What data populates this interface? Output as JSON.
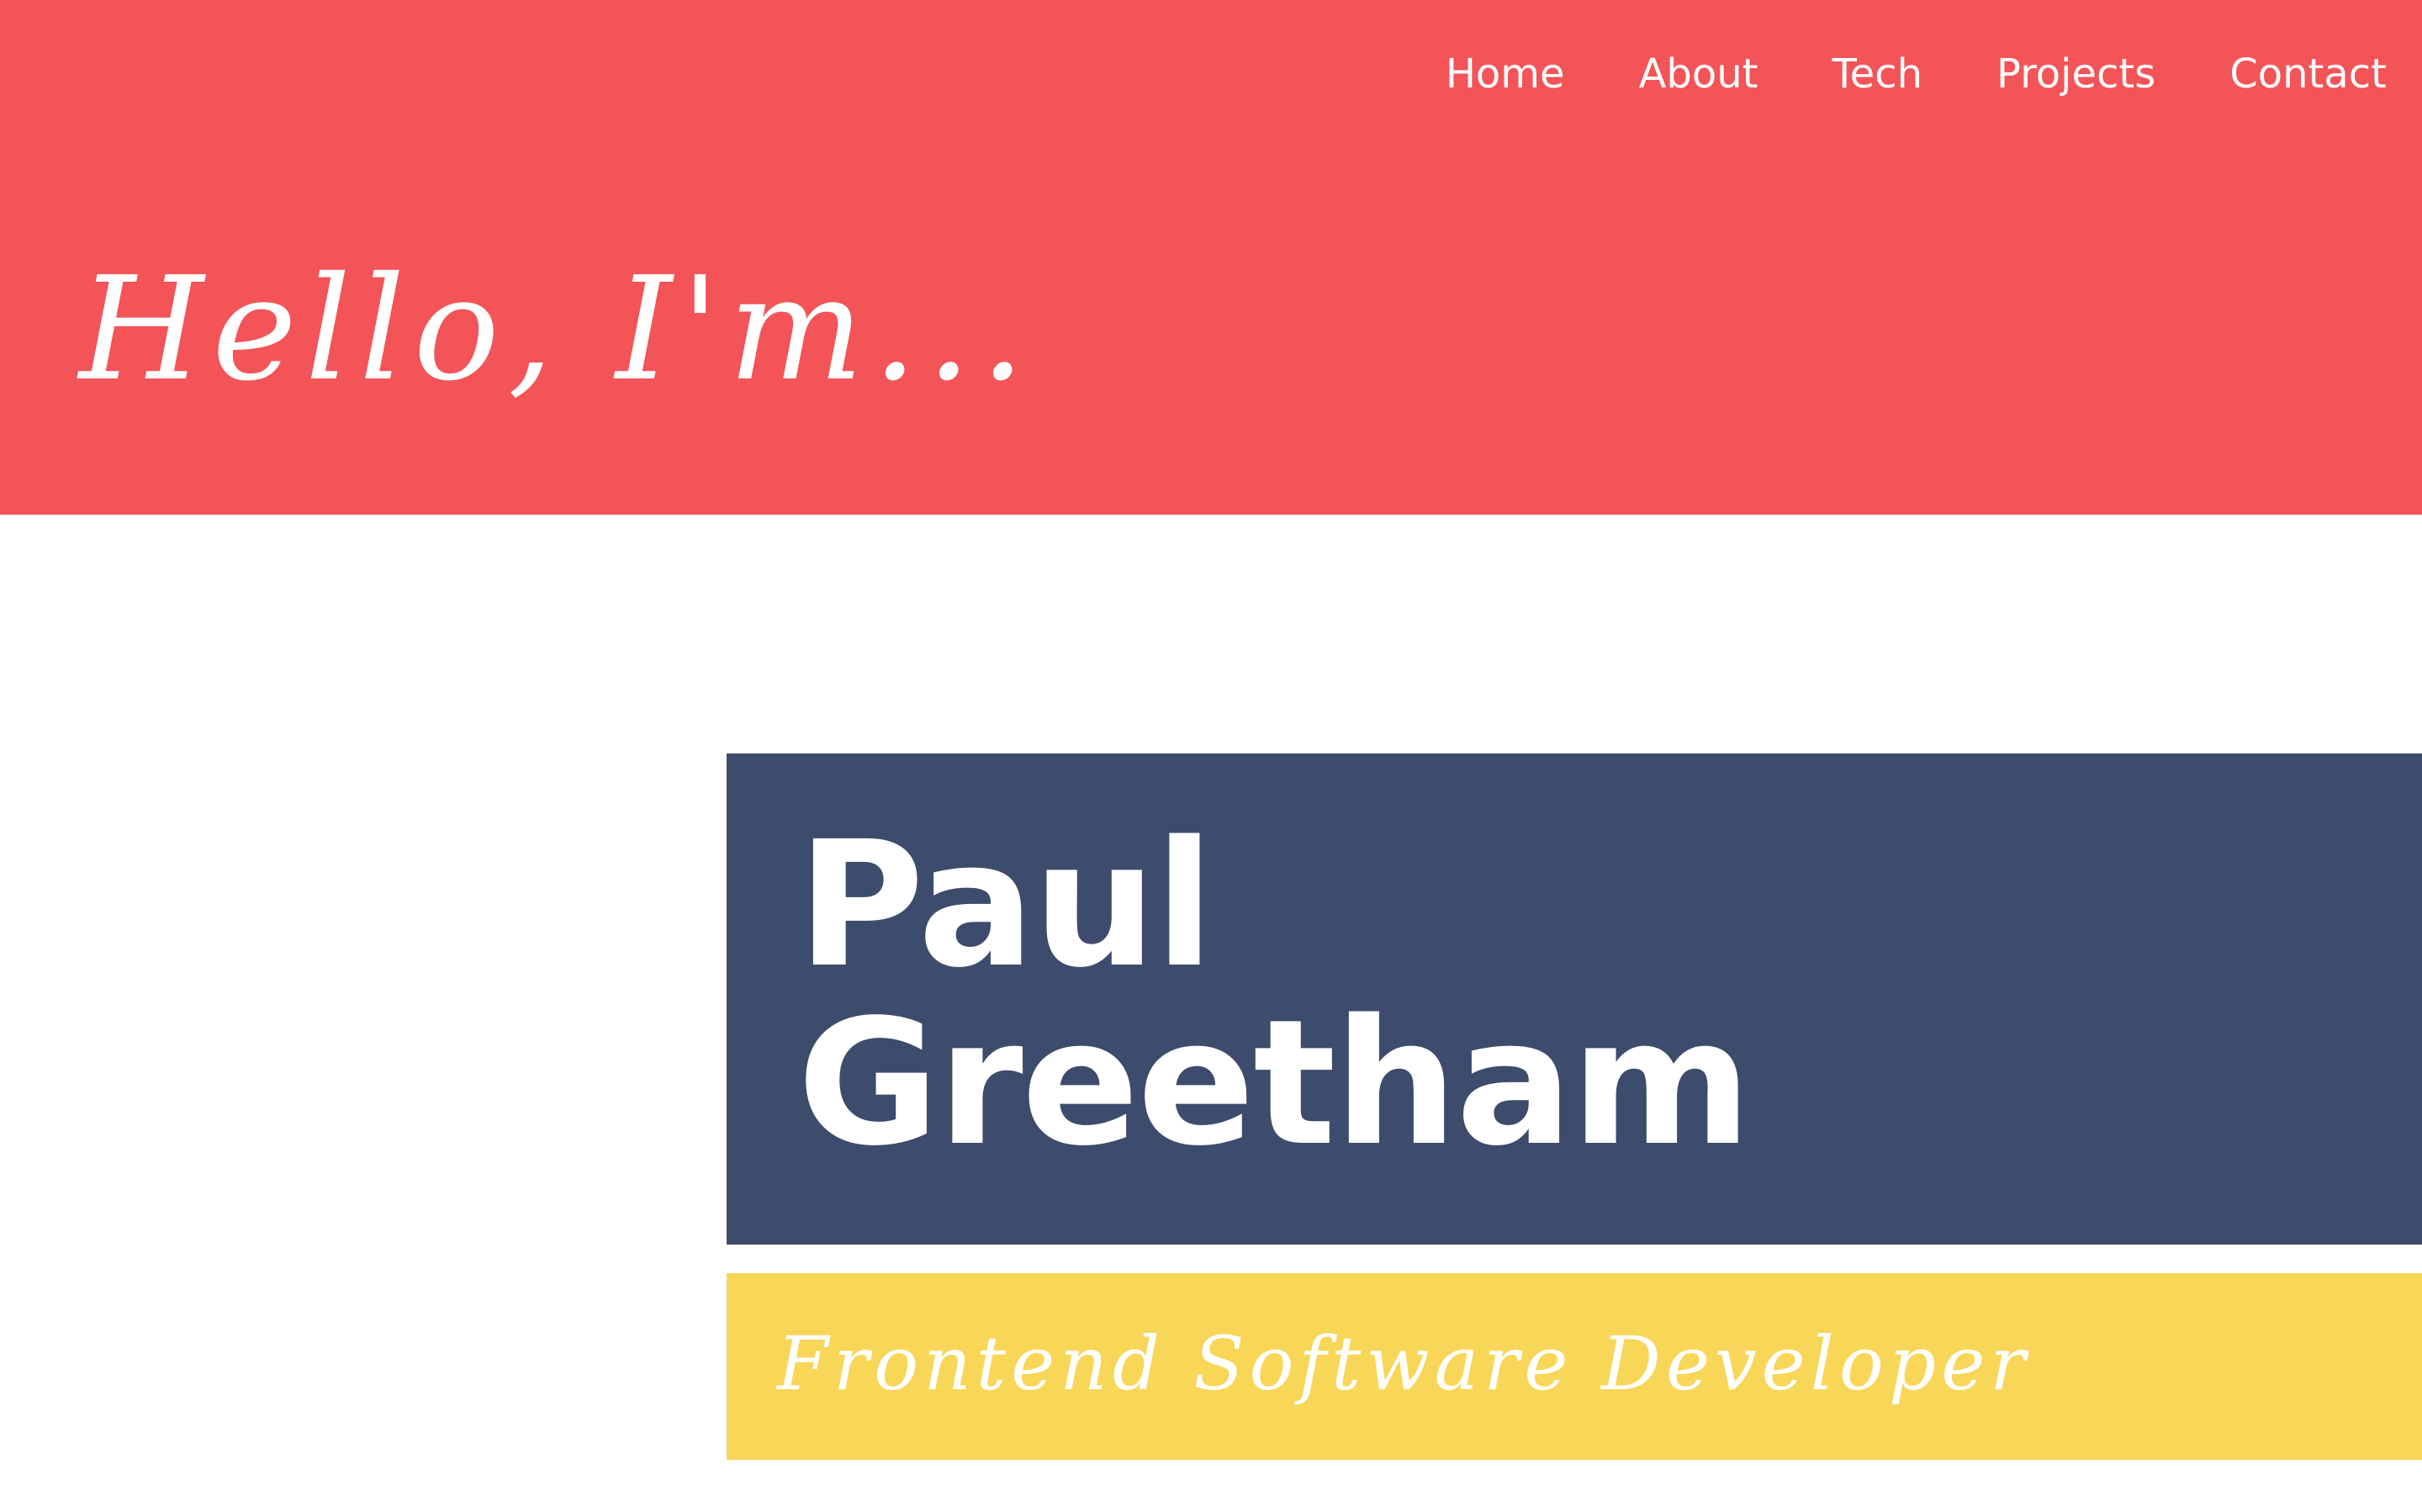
{
  "nav": {
    "items": [
      {
        "label": "Home"
      },
      {
        "label": "About"
      },
      {
        "label": "Tech"
      },
      {
        "label": "Projects"
      },
      {
        "label": "Contact"
      }
    ]
  },
  "hero": {
    "greeting": "Hello, I'm...",
    "first_name": "Paul",
    "last_name": "Greetham",
    "role": "Frontend Software Developer"
  },
  "colors": {
    "hero_background": "#f25458",
    "name_card_background": "#3d4b6d",
    "role_strip_background": "#f8d658",
    "text": "#ffffff"
  }
}
